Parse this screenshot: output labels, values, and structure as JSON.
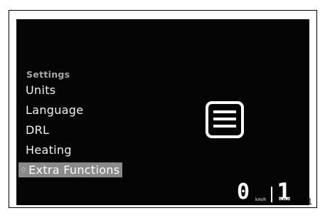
{
  "menu": {
    "header": "Settings",
    "items": [
      {
        "label": "Units"
      },
      {
        "label": "Language"
      },
      {
        "label": "DRL"
      },
      {
        "label": "Heating"
      },
      {
        "label": "Extra Functions",
        "selected": true
      }
    ],
    "selected_marker": "♢"
  },
  "dashboard": {
    "speed": "0",
    "speed_unit": "km/h",
    "gear": "1"
  },
  "figure": {
    "reference_code": "I00260-01"
  },
  "icons": {
    "center": "menu-list-icon"
  },
  "colors": {
    "screen_bg": "#050505",
    "text": "#f2f2f2",
    "header_text": "#a8a8a8",
    "selection_bg": "#8a8a8a"
  }
}
